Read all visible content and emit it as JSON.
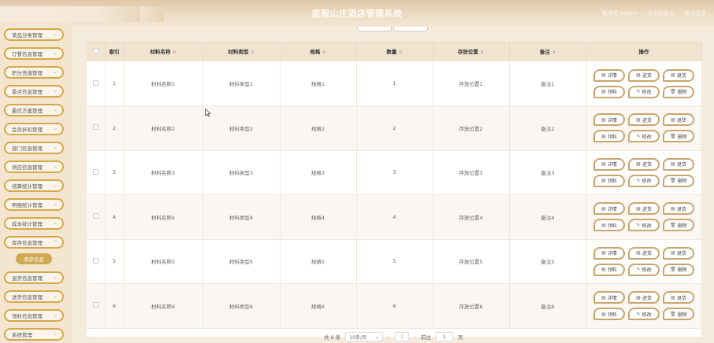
{
  "header": {
    "title": "度假山庄酒店管理系统",
    "links": [
      "管理员 admin",
      "退出到前台",
      "退出登录"
    ]
  },
  "sidebar": {
    "items": [
      "菜品分类管理",
      "订餐信息管理",
      "积分充值管理",
      "景点信息管理",
      "最优方案管理",
      "会员折扣管理",
      "部门信息管理",
      "供应信息管理",
      "结算统计管理",
      "明细统计管理",
      "成本统计管理",
      "库存信息管理"
    ],
    "sub_item": "库存信息",
    "items_after": [
      "退货信息管理",
      "进货信息管理",
      "领料信息管理",
      "系统管理"
    ]
  },
  "table": {
    "headers": [
      "索引",
      "材料名称",
      "材料类型",
      "规格",
      "数量",
      "存放位置",
      "备注",
      "操作"
    ],
    "rows": [
      {
        "index": "1",
        "name": "材料名称1",
        "type": "材料类型1",
        "spec": "规格1",
        "qty": "1",
        "location": "存放位置1",
        "note": "备注1"
      },
      {
        "index": "2",
        "name": "材料名称2",
        "type": "材料类型2",
        "spec": "规格2",
        "qty": "2",
        "location": "存放位置2",
        "note": "备注2"
      },
      {
        "index": "3",
        "name": "材料名称3",
        "type": "材料类型3",
        "spec": "规格3",
        "qty": "3",
        "location": "存放位置3",
        "note": "备注3"
      },
      {
        "index": "4",
        "name": "材料名称4",
        "type": "材料类型4",
        "spec": "规格4",
        "qty": "4",
        "location": "存放位置4",
        "note": "备注4"
      },
      {
        "index": "5",
        "name": "材料名称5",
        "type": "材料类型5",
        "spec": "规格5",
        "qty": "5",
        "location": "存放位置5",
        "note": "备注5"
      },
      {
        "index": "6",
        "name": "材料名称6",
        "type": "材料类型6",
        "spec": "规格6",
        "qty": "6",
        "location": "存放位置6",
        "note": "备注6"
      }
    ],
    "actions": [
      {
        "label": "详情",
        "icon": "doc-icon"
      },
      {
        "label": "进货",
        "icon": "doc-icon"
      },
      {
        "label": "退货",
        "icon": "doc-icon"
      },
      {
        "label": "领料",
        "icon": "doc-icon"
      },
      {
        "label": "修改",
        "icon": "edit-icon"
      },
      {
        "label": "删除",
        "icon": "trash-icon"
      }
    ]
  },
  "pagination": {
    "total": "共 6 条",
    "page_size": "10条/页",
    "current_page": "1",
    "goto_label": "前往",
    "goto_value": "1",
    "page_suffix": "页"
  },
  "colors": {
    "accent": "#d0a851",
    "header_bg": "#e0c8a8",
    "table_header_bg": "#f0e3cf"
  }
}
